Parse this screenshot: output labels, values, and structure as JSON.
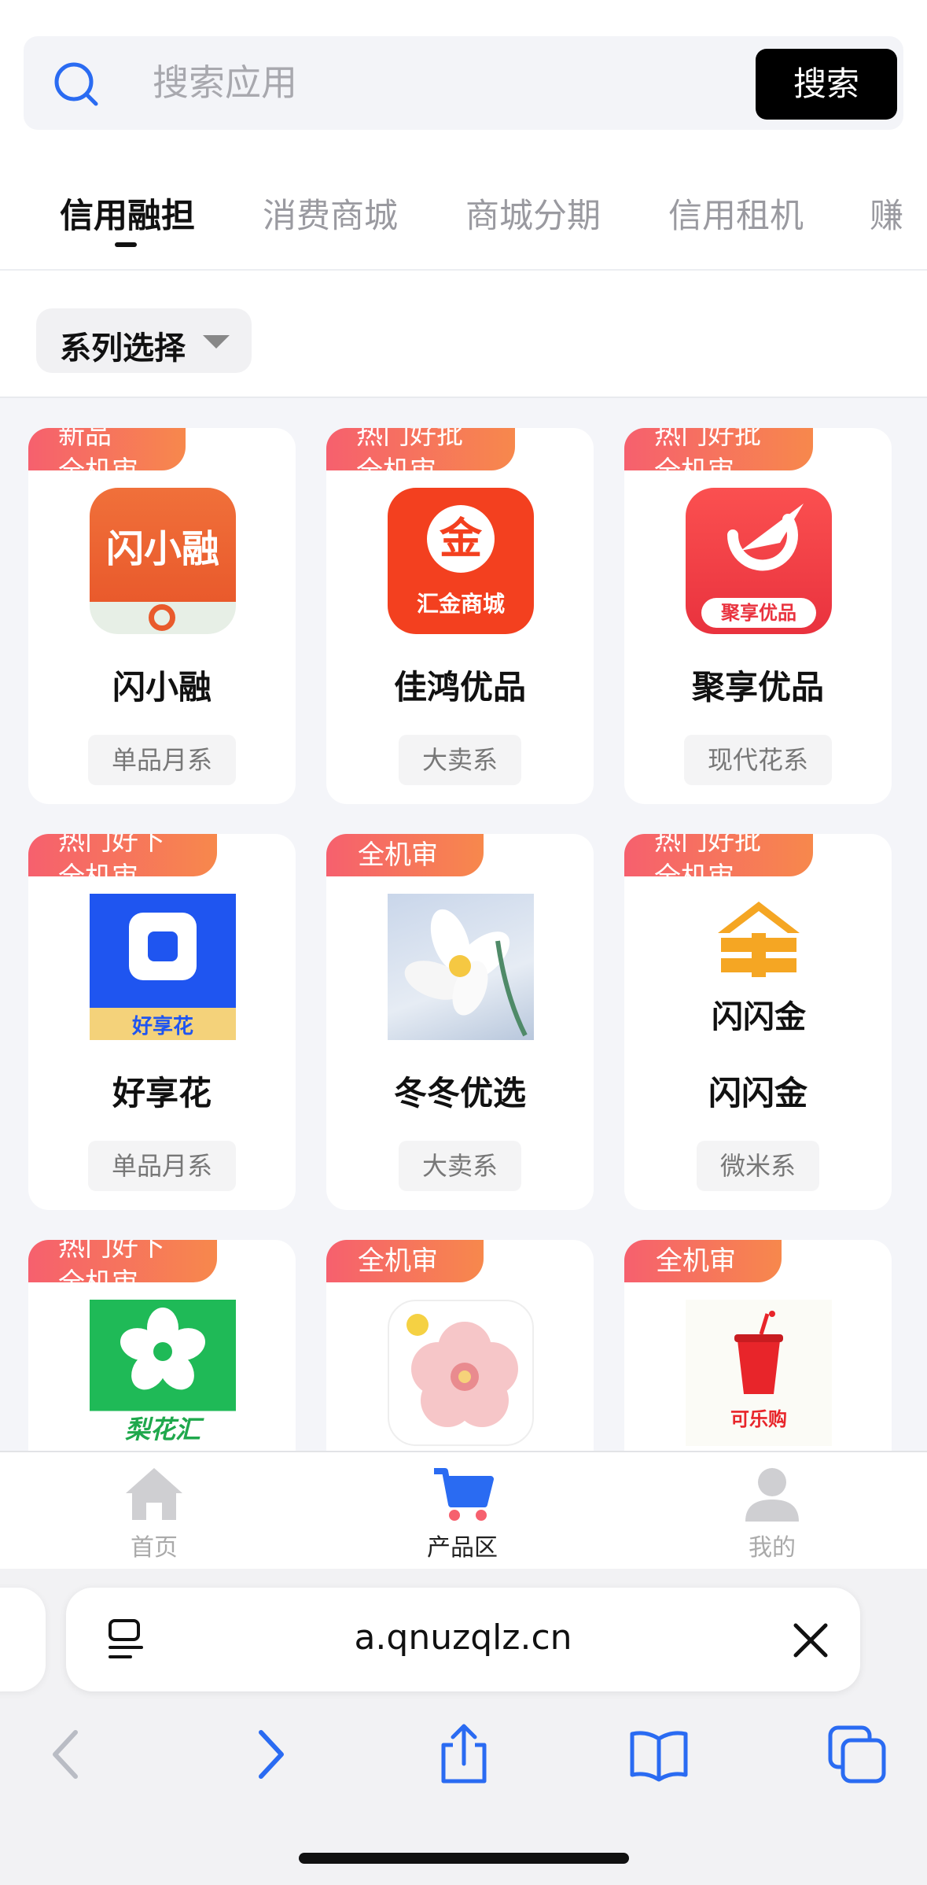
{
  "search": {
    "placeholder": "搜索应用",
    "button": "搜索"
  },
  "tabs": [
    "信用融担",
    "消费商城",
    "商城分期",
    "信用租机",
    "赚"
  ],
  "filter": {
    "label": "系列选择"
  },
  "products": [
    {
      "name": "闪小融",
      "tag": "单品月系",
      "badge": [
        "新品",
        "全机审"
      ],
      "icon_text": "闪小融"
    },
    {
      "name": "佳鸿优品",
      "tag": "大卖系",
      "badge": [
        "热门好批",
        "全机审"
      ],
      "icon_text": "汇金商城"
    },
    {
      "name": "聚享优品",
      "tag": "现代花系",
      "badge": [
        "热门好批",
        "全机审"
      ],
      "icon_text": "聚享优品"
    },
    {
      "name": "好享花",
      "tag": "单品月系",
      "badge": [
        "热门好下",
        "全机审"
      ],
      "icon_text": "好享花"
    },
    {
      "name": "冬冬优选",
      "tag": "大卖系",
      "badge": [
        "全机审"
      ],
      "icon_text": ""
    },
    {
      "name": "闪闪金",
      "tag": "微米系",
      "badge": [
        "热门好批",
        "全机审"
      ],
      "icon_text": "闪闪金"
    },
    {
      "name": "",
      "tag": "",
      "badge": [
        "热门好下",
        "全机审"
      ],
      "icon_text": "梨花汇"
    },
    {
      "name": "",
      "tag": "",
      "badge": [
        "全机审"
      ],
      "icon_text": ""
    },
    {
      "name": "",
      "tag": "",
      "badge": [
        "全机审"
      ],
      "icon_text": "可乐购"
    }
  ],
  "bottom_nav": [
    {
      "label": "首页",
      "icon": "home-icon"
    },
    {
      "label": "产品区",
      "icon": "cart-icon"
    },
    {
      "label": "我的",
      "icon": "person-icon"
    }
  ],
  "browser": {
    "url": "a.qnuzqlz.cn"
  },
  "colors": {
    "accent_blue": "#2a6bf2",
    "badge_start": "#f6606e",
    "badge_end": "#f7884c",
    "search_btn": "#000000"
  }
}
